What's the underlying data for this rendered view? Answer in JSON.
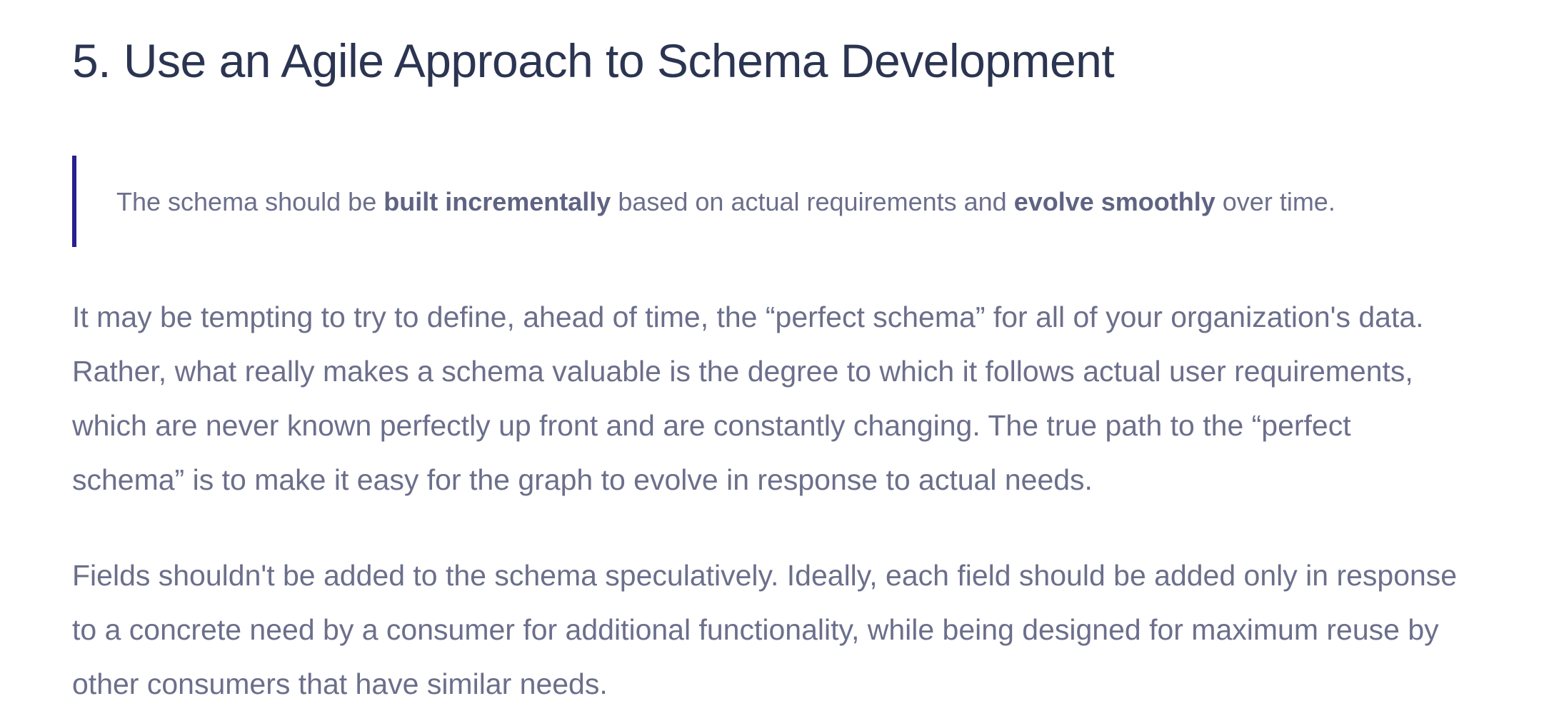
{
  "section": {
    "heading": "5. Use an Agile Approach to Schema Development"
  },
  "callout": {
    "part1": "The schema should be ",
    "bold1": "built incrementally",
    "part2": " based on actual requirements and ",
    "bold2": "evolve smoothly",
    "part3": " over time."
  },
  "paragraphs": [
    {
      "lines": [
        "It may be tempting to try to define, ahead of time, the “perfect schema” for all of your organization's data.",
        "Rather, what really makes a schema valuable is the degree to which it follows actual user requirements,",
        "which are never known perfectly up front and are constantly changing. The true path to the “perfect",
        "schema” is to make it easy for the graph to evolve in response to actual needs."
      ]
    },
    {
      "lines": [
        "Fields shouldn't be added to the schema speculatively. Ideally, each field should be added only in response",
        "to a concrete need by a consumer for additional functionality, while being designed for maximum reuse by",
        "other consumers that have similar needs."
      ]
    }
  ],
  "colors": {
    "heading": "#2b3552",
    "body_text": "#6b6f8b",
    "callout_border": "#2a1f8f",
    "background": "#ffffff"
  }
}
